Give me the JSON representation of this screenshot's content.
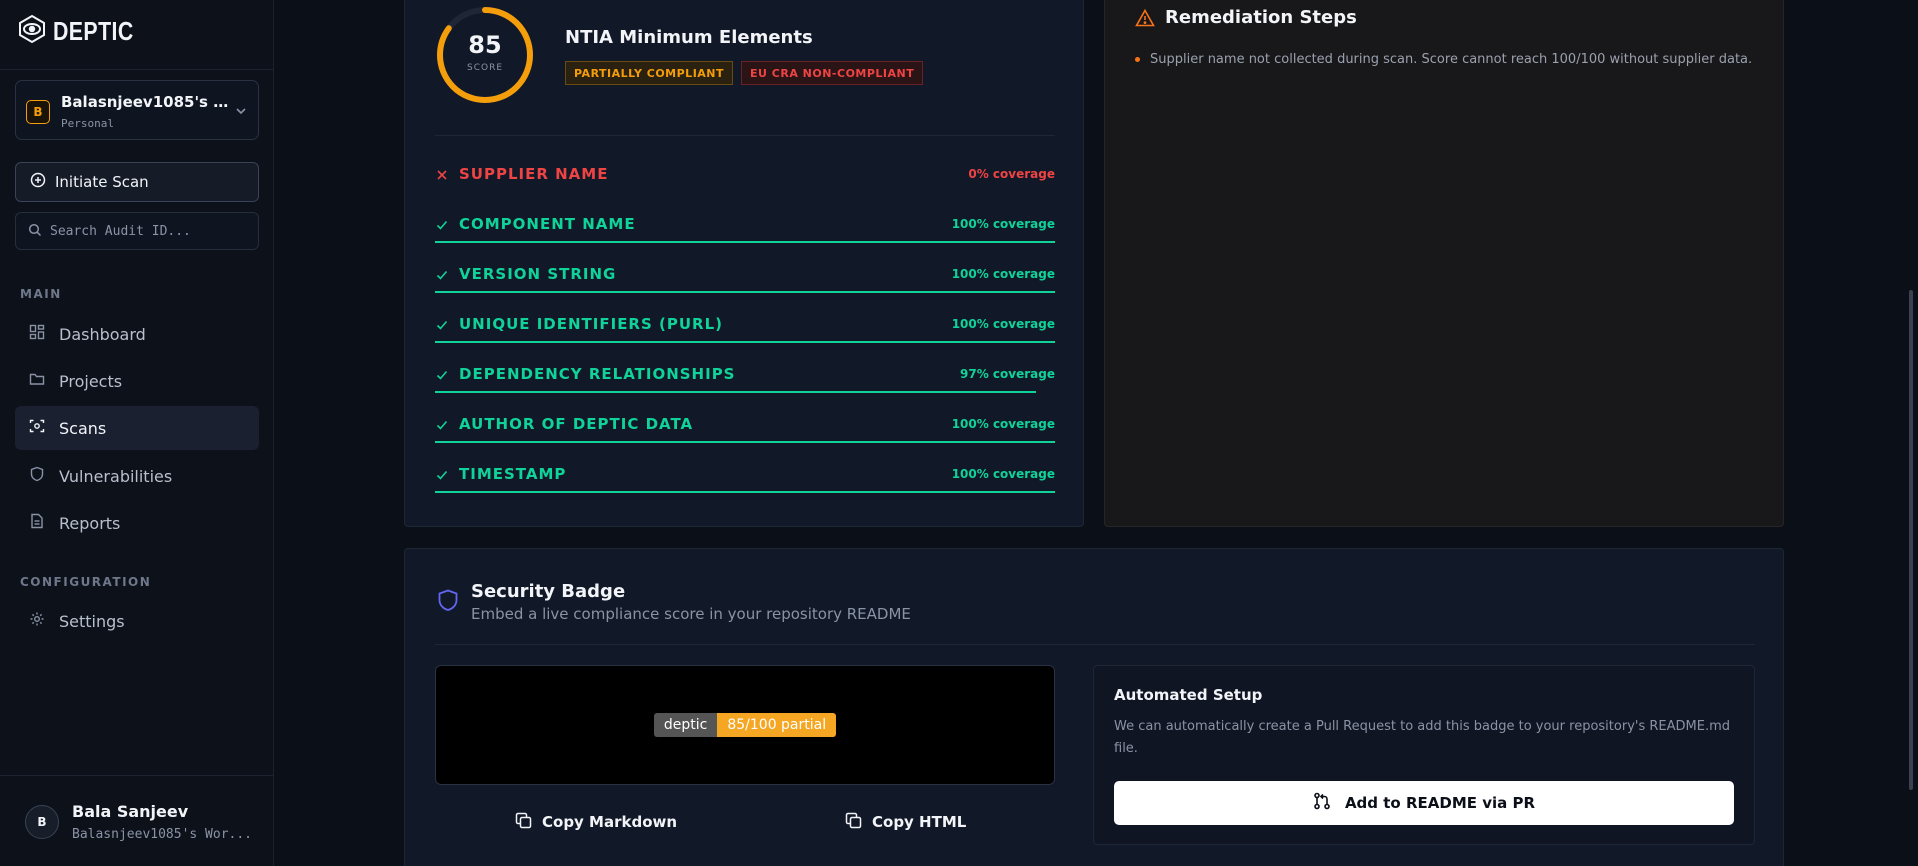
{
  "brand": {
    "name": "DEPTIC"
  },
  "workspace": {
    "avatar": "B",
    "name": "Balasnjeev1085's Wor...",
    "type": "Personal"
  },
  "actions": {
    "initiate_scan": "Initiate Scan"
  },
  "search": {
    "placeholder": "Search Audit ID..."
  },
  "nav": {
    "main_label": "MAIN",
    "items": [
      {
        "label": "Dashboard",
        "icon": "dashboard-icon",
        "active": false
      },
      {
        "label": "Projects",
        "icon": "folder-icon",
        "active": false
      },
      {
        "label": "Scans",
        "icon": "scan-icon",
        "active": true
      },
      {
        "label": "Vulnerabilities",
        "icon": "shield-icon",
        "active": false
      },
      {
        "label": "Reports",
        "icon": "document-icon",
        "active": false
      }
    ],
    "config_label": "CONFIGURATION",
    "config_items": [
      {
        "label": "Settings",
        "icon": "gear-icon"
      }
    ]
  },
  "user": {
    "avatar": "B",
    "name": "Bala Sanjeev",
    "workspace": "Balasnjeev1085's Wor..."
  },
  "ntia": {
    "score": "85",
    "score_label": "SCORE",
    "score_value": 0.85,
    "title": "NTIA Minimum Elements",
    "badges": {
      "partial": "PARTIALLY COMPLIANT",
      "cra": "EU CRA NON-COMPLIANT"
    },
    "criteria": [
      {
        "name": "SUPPLIER NAME",
        "coverage": "0% coverage",
        "value": 0,
        "status": "fail"
      },
      {
        "name": "COMPONENT NAME",
        "coverage": "100% coverage",
        "value": 100,
        "status": "pass"
      },
      {
        "name": "VERSION STRING",
        "coverage": "100% coverage",
        "value": 100,
        "status": "pass"
      },
      {
        "name": "UNIQUE IDENTIFIERS (PURL)",
        "coverage": "100% coverage",
        "value": 100,
        "status": "pass"
      },
      {
        "name": "DEPENDENCY RELATIONSHIPS",
        "coverage": "97% coverage",
        "value": 97,
        "status": "pass"
      },
      {
        "name": "AUTHOR OF DEPTIC DATA",
        "coverage": "100% coverage",
        "value": 100,
        "status": "pass"
      },
      {
        "name": "TIMESTAMP",
        "coverage": "100% coverage",
        "value": 100,
        "status": "pass"
      }
    ]
  },
  "remediation": {
    "title": "Remediation Steps",
    "items": [
      "Supplier name not collected during scan. Score cannot reach 100/100 without supplier data."
    ]
  },
  "security_badge": {
    "title": "Security Badge",
    "subtitle": "Embed a live compliance score in your repository README",
    "badge_left": "deptic",
    "badge_right": "85/100 partial",
    "copy_markdown": "Copy Markdown",
    "copy_html": "Copy HTML",
    "automated": {
      "title": "Automated Setup",
      "description": "We can automatically create a Pull Request to add this badge to your repository's README.md file.",
      "button": "Add to README via PR"
    }
  },
  "colors": {
    "accent_orange": "#f59e0b",
    "success": "#10d39a",
    "danger": "#ef4444"
  }
}
